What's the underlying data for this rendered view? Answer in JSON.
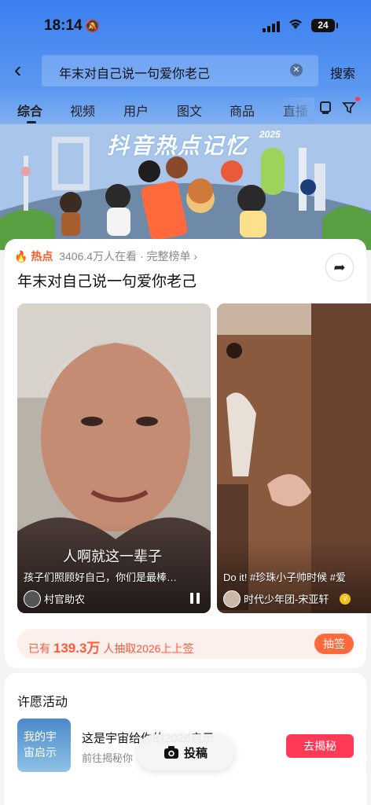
{
  "status_bar": {
    "time": "18:14",
    "battery": "24"
  },
  "search": {
    "query": "年末对自己说一句爱你老己",
    "button": "搜索"
  },
  "tabs": [
    "综合",
    "视频",
    "用户",
    "图文",
    "商品",
    "直播"
  ],
  "banner": {
    "title": "抖音热点记忆",
    "year": "2025"
  },
  "hot": {
    "label": "热点",
    "viewers": "3406.4万人在看",
    "rank_link": "完整榜单",
    "topic": "年末对自己说一句爱你老己"
  },
  "videos": [
    {
      "overlay_text": "人啊就这一辈子",
      "caption": "孩子们照顾好自己，你们是最棒…",
      "author": "村官助农"
    },
    {
      "caption": "Do it! #珍珠小子帅时候 #爱",
      "author": "时代少年团-宋亚轩"
    }
  ],
  "lottery": {
    "prefix": "已有",
    "count": "139.3万",
    "suffix": "人抽取2026上上签",
    "button": "抽签"
  },
  "wish": {
    "section_title": "许愿活动",
    "thumb_text": "我的宇宙启示",
    "name": "这是宇宙给你的2026启示",
    "sub": "前往揭秘你",
    "button": "去揭秘"
  },
  "post_button": "投稿",
  "colors": {
    "accent_orange": "#ff5a23",
    "accent_red": "#ff3a57",
    "sky_blue": "#3a7ff0"
  }
}
